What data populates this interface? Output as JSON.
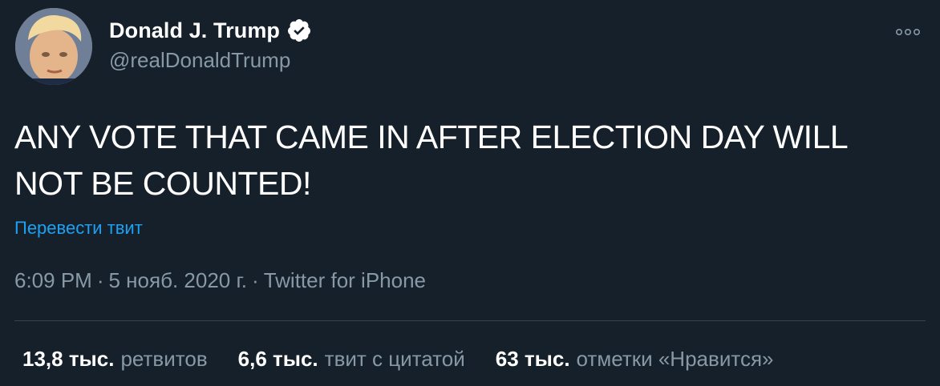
{
  "author": {
    "display_name": "Donald J. Trump",
    "handle": "@realDonaldTrump",
    "verified": true,
    "avatar_icon": "profile-photo"
  },
  "tweet": {
    "text": "ANY VOTE THAT CAME IN AFTER ELECTION DAY WILL NOT BE COUNTED!",
    "translate_label": "Перевести твит",
    "time": "6:09 PM",
    "date": "5 нояб. 2020 г.",
    "separator": "·",
    "source": "Twitter for iPhone"
  },
  "stats": [
    {
      "count": "13,8 тыс.",
      "label": "ретвитов"
    },
    {
      "count": "6,6 тыс.",
      "label": "твит с цитатой"
    },
    {
      "count": "63 тыс.",
      "label": "отметки «Нравится»"
    }
  ],
  "colors": {
    "background": "#15202b",
    "text": "#ffffff",
    "secondary": "#8899a6",
    "link": "#1da1f2",
    "divider": "#38444d"
  }
}
